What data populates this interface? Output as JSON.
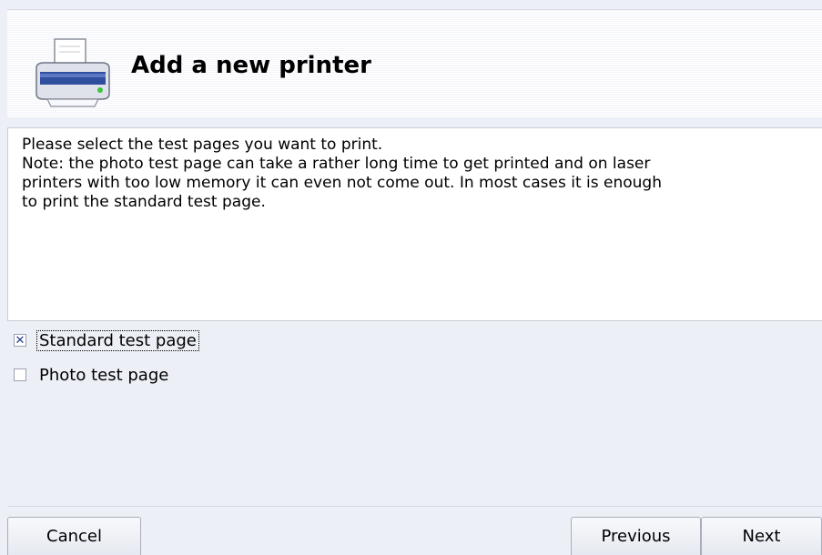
{
  "header": {
    "title": "Add a new printer",
    "icon": "printer-icon"
  },
  "description": {
    "lines": [
      "Please select the test pages you want to print.",
      "Note: the photo test page can take a rather long time to get printed and on laser",
      "printers with too low memory it can even not come out. In most cases it is enough",
      "to print the standard test page."
    ]
  },
  "options": [
    {
      "label": "Standard test page",
      "checked": true,
      "focused": true
    },
    {
      "label": "Photo test page",
      "checked": false,
      "focused": false
    }
  ],
  "buttons": {
    "cancel": "Cancel",
    "previous": "Previous",
    "next": "Next"
  },
  "colors": {
    "check_mark": "#1f3b8c",
    "background": "#eceff5"
  }
}
